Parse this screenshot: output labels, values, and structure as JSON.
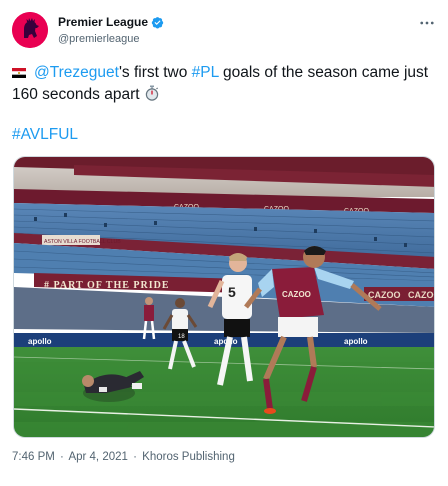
{
  "account": {
    "display_name": "Premier League",
    "handle": "@premierleague",
    "verified": true,
    "brand_color": "#e90052"
  },
  "tweet": {
    "mention": "@Trezeguet",
    "text_after_mention": "'s first two ",
    "hashtag_inline": "#PL",
    "text_after_hashtag": " goals of the season came just 160 seconds apart",
    "hashtag_line": "#AVLFUL",
    "link_color": "#1d9bf0"
  },
  "media": {
    "banner_text": "# PART OF THE PRIDE",
    "stand_sign": "ASTON VILLA FOOTBALL CLUB",
    "board_sponsor": "CAZOO",
    "board_sponsor_2": "apollo",
    "player_one_number": "5",
    "player_two_number": "18"
  },
  "meta": {
    "time": "7:46 PM",
    "separator": "·",
    "date": "Apr 4, 2021",
    "source": "Khoros Publishing"
  },
  "icons": {
    "verified": "verified-badge-icon",
    "more": "more-options-icon",
    "flag": "egypt-flag-icon",
    "stopwatch": "stopwatch-icon"
  }
}
